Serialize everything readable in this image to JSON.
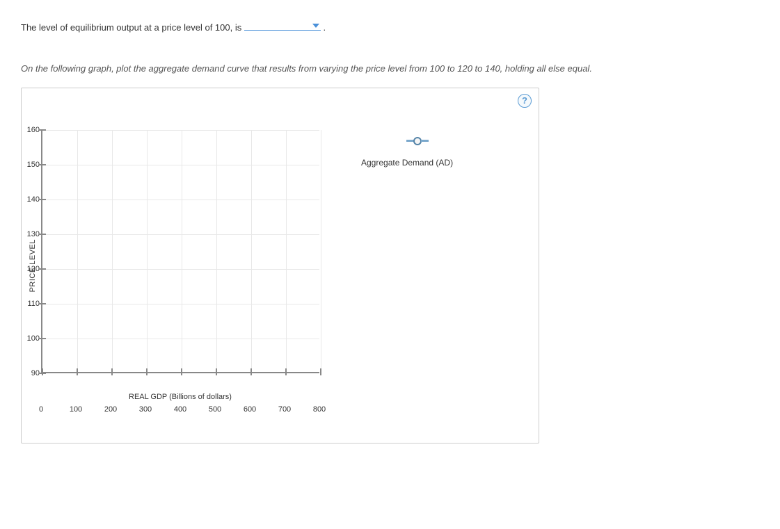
{
  "question": {
    "prefix": "The level of equilibrium output at a price level of 100, is ",
    "suffix": " ."
  },
  "instruction": "On the following graph, plot the aggregate demand curve that results from varying the price level from 100 to 120 to 140, holding all else equal.",
  "help_label": "?",
  "legend": {
    "series_label": "Aggregate Demand (AD)"
  },
  "chart_data": {
    "type": "scatter",
    "title": "",
    "xlabel": "REAL GDP (Billions of dollars)",
    "ylabel": "PRICE LEVEL",
    "xlim": [
      0,
      800
    ],
    "ylim": [
      90,
      160
    ],
    "x_ticks": [
      0,
      100,
      200,
      300,
      400,
      500,
      600,
      700,
      800
    ],
    "y_ticks": [
      90,
      100,
      110,
      120,
      130,
      140,
      150,
      160
    ],
    "series": [
      {
        "name": "Aggregate Demand (AD)",
        "x": [],
        "y": []
      }
    ],
    "grid": true
  }
}
